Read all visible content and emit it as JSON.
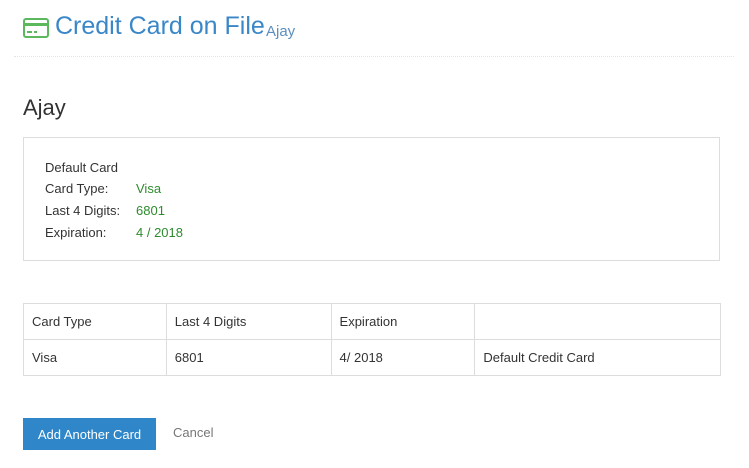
{
  "header": {
    "title": "Credit Card on File",
    "subtitle": "Ajay",
    "icon": "credit-card-icon",
    "icon_color": "#5cb85c",
    "title_color": "#3a87c8"
  },
  "account_name": "Ajay",
  "default_card": {
    "title": "Default Card",
    "card_type_label": "Card Type:",
    "card_type_value": "Visa",
    "last4_label": "Last 4 Digits:",
    "last4_value": "6801",
    "expiration_label": "Expiration:",
    "expiration_value": "4 / 2018",
    "value_color": "#2e8b2e"
  },
  "table": {
    "headers": [
      "Card Type",
      "Last 4 Digits",
      "Expiration",
      ""
    ],
    "rows": [
      [
        "Visa",
        "6801",
        "4/ 2018",
        "Default Credit Card"
      ]
    ]
  },
  "actions": {
    "add_label": "Add Another Card",
    "cancel_label": "Cancel",
    "primary_color": "#2f86c8"
  }
}
